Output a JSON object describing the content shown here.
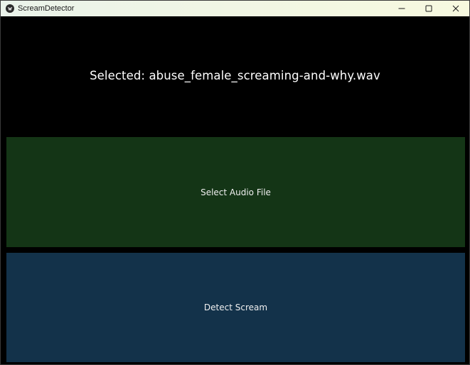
{
  "window": {
    "title": "ScreamDetector",
    "controls": {
      "minimize_icon": "minimize-icon",
      "maximize_icon": "maximize-icon",
      "close_icon": "close-icon"
    }
  },
  "main": {
    "selected_text": "Selected: abuse_female_screaming-and-why.wav",
    "select_button_label": "Select Audio File",
    "detect_button_label": "Detect Scream"
  },
  "colors": {
    "background": "#000000",
    "select_button": "#143516",
    "detect_button": "#13324a",
    "text": "#ffffff"
  }
}
